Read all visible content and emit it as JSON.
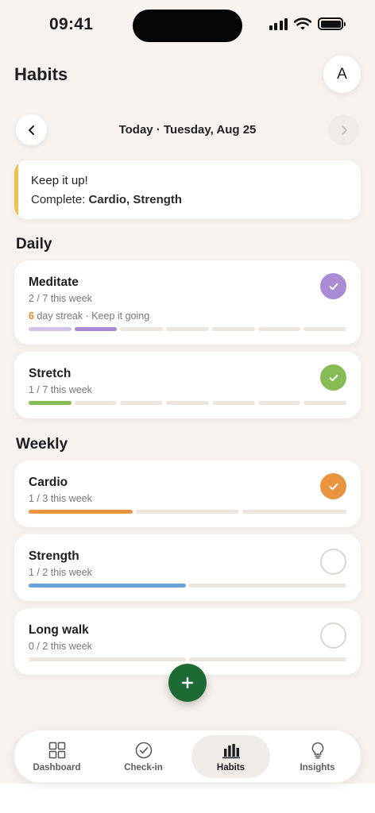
{
  "status_bar": {
    "time": "09:41"
  },
  "header": {
    "title": "Habits",
    "avatar_initial": "A"
  },
  "date_nav": {
    "label": "Today · Tuesday, Aug 25",
    "prev_icon": "chevron-left-icon",
    "next_icon": "chevron-right-icon"
  },
  "banner": {
    "title": "Keep it up!",
    "complete_prefix": "Complete: ",
    "complete_items": "Cardio, Strength",
    "accent_color": "#f0c14b"
  },
  "sections": {
    "daily": "Daily",
    "weekly": "Weekly"
  },
  "habits": [
    {
      "name": "Meditate",
      "progress_text": "2 / 7 this week",
      "streak_count": "6",
      "streak_text": " day streak · Keep it going",
      "done": 2,
      "total": 7,
      "checked": true,
      "color": "#a98bd6",
      "light_color": "#d3c3ea"
    },
    {
      "name": "Stretch",
      "progress_text": "1 / 7 this week",
      "done": 1,
      "total": 7,
      "checked": true,
      "color": "#86bb55"
    },
    {
      "name": "Cardio",
      "progress_text": "1 / 3 this week",
      "done": 1,
      "total": 3,
      "checked": true,
      "color": "#ea9440"
    },
    {
      "name": "Strength",
      "progress_text": "1 / 2 this week",
      "done": 1,
      "total": 2,
      "checked": false,
      "color": "#6aa3db"
    },
    {
      "name": "Long walk",
      "progress_text": "0 / 2 this week",
      "done": 0,
      "total": 2,
      "checked": false,
      "color": "#d9d6d2"
    }
  ],
  "fab": {
    "icon": "plus-icon"
  },
  "tabbar": {
    "active": "Habits",
    "items": [
      {
        "label": "Dashboard",
        "icon": "grid-icon"
      },
      {
        "label": "Check-in",
        "icon": "check-circle-icon"
      },
      {
        "label": "Habits",
        "icon": "bar-chart-icon"
      },
      {
        "label": "Insights",
        "icon": "lightbulb-icon"
      }
    ]
  }
}
